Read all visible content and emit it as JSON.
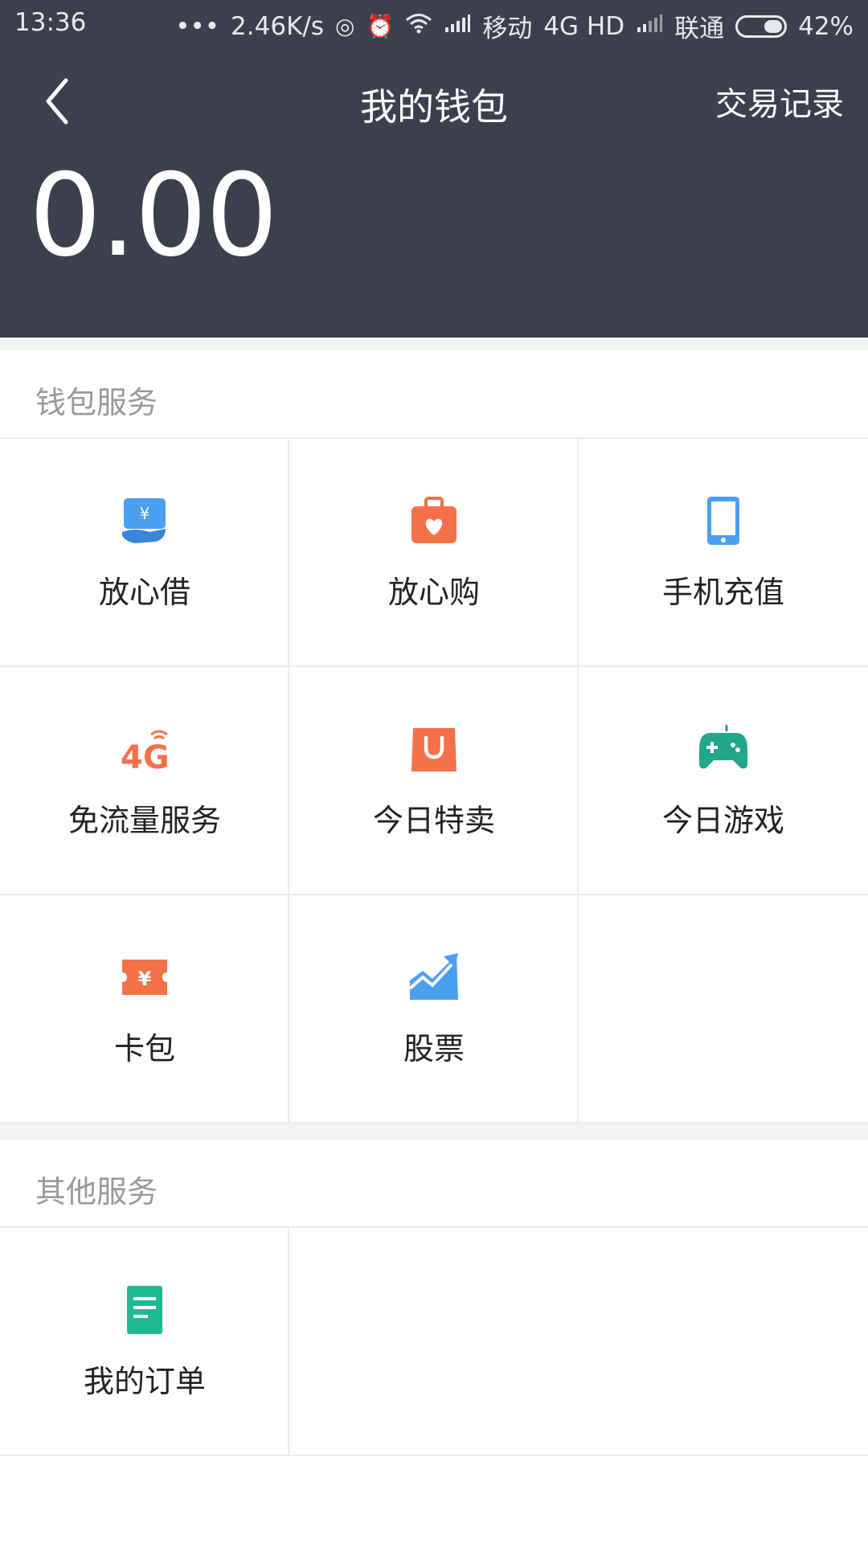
{
  "status_bar": {
    "time": "13:36",
    "dots": "•••",
    "speed": "2.46K/s",
    "carrier1": "移动",
    "network": "4G HD",
    "carrier2": "联通",
    "battery": "42%"
  },
  "header": {
    "title": "我的钱包",
    "records_label": "交易记录",
    "balance": "0.00"
  },
  "wallet_services": {
    "heading": "钱包服务",
    "items": [
      {
        "label": "放心借",
        "icon": "loan-icon",
        "color": "#4a9ff0"
      },
      {
        "label": "放心购",
        "icon": "shopping-bag-heart-icon",
        "color": "#f4714a"
      },
      {
        "label": "手机充值",
        "icon": "phone-icon",
        "color": "#4a9ff0"
      },
      {
        "label": "免流量服务",
        "icon": "4g-icon",
        "color": "#f4714a"
      },
      {
        "label": "今日特卖",
        "icon": "shopping-bag-icon",
        "color": "#f4714a"
      },
      {
        "label": "今日游戏",
        "icon": "gamepad-icon",
        "color": "#22a68c"
      },
      {
        "label": "卡包",
        "icon": "coupon-icon",
        "color": "#f4714a"
      },
      {
        "label": "股票",
        "icon": "stock-chart-icon",
        "color": "#4a9ff0"
      }
    ]
  },
  "other_services": {
    "heading": "其他服务",
    "items": [
      {
        "label": "我的订单",
        "icon": "order-icon",
        "color": "#1fba8f"
      }
    ]
  },
  "colors": {
    "header_bg": "#3b404c",
    "divider": "#ececec",
    "gap_bg": "#f2f3f5"
  }
}
